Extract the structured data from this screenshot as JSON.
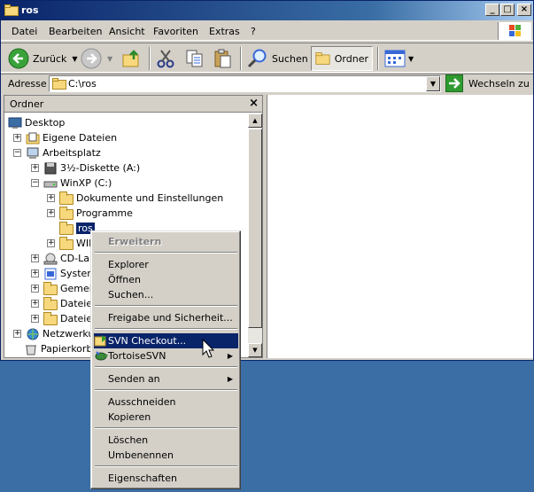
{
  "window": {
    "title": "ros"
  },
  "menu": [
    "Datei",
    "Bearbeiten",
    "Ansicht",
    "Favoriten",
    "Extras",
    "?"
  ],
  "toolbar": {
    "back_label": "Zurück",
    "search_label": "Suchen",
    "folders_label": "Ordner"
  },
  "address": {
    "label": "Adresse",
    "value": "C:\\ros",
    "go_label": "Wechseln zu"
  },
  "folderpane": {
    "title": "Ordner",
    "tree": [
      {
        "label": "Desktop",
        "icon": "desktop-icon"
      },
      {
        "label": "Eigene Dateien",
        "icon": "my-documents-icon",
        "expander": "+"
      },
      {
        "label": "Arbeitsplatz",
        "icon": "my-computer-icon",
        "expander": "−"
      },
      {
        "label": "3½-Diskette (A:)",
        "icon": "floppy-icon",
        "expander": "+"
      },
      {
        "label": "WinXP (C:)",
        "icon": "hard-drive-icon",
        "expander": "−"
      },
      {
        "label": "Dokumente und Einstellungen",
        "icon": "folder-icon",
        "expander": "+"
      },
      {
        "label": "Programme",
        "icon": "folder-icon",
        "expander": "+"
      },
      {
        "label": "ros",
        "icon": "folder-open-icon",
        "selected": true
      },
      {
        "label": "WIN",
        "icon": "folder-icon",
        "expander": "+"
      },
      {
        "label": "CD-Lau",
        "icon": "cd-drive-icon",
        "expander": "+"
      },
      {
        "label": "System",
        "icon": "control-panel-icon",
        "expander": "+"
      },
      {
        "label": "Gemein",
        "icon": "folder-icon",
        "expander": "+"
      },
      {
        "label": "Dateien",
        "icon": "folder-icon",
        "expander": "+"
      },
      {
        "label": "Dateien",
        "icon": "folder-icon",
        "expander": "+"
      },
      {
        "label": "Netzwerkum",
        "icon": "network-icon",
        "expander": "+"
      },
      {
        "label": "Papierkorb",
        "icon": "recycle-bin-icon"
      }
    ]
  },
  "context_menu": {
    "items": [
      {
        "label": "Erweitern",
        "style": "disabled"
      },
      {
        "label": "Explorer"
      },
      {
        "label": "Öffnen"
      },
      {
        "label": "Suchen..."
      },
      {
        "label": "Freigabe und Sicherheit..."
      },
      {
        "label": "SVN Checkout...",
        "style": "highlighted",
        "icon": "svn-checkout-icon"
      },
      {
        "label": "TortoiseSVN",
        "submenu": true,
        "icon": "tortoisesvn-icon"
      },
      {
        "label": "Senden an",
        "submenu": true
      },
      {
        "label": "Ausschneiden"
      },
      {
        "label": "Kopieren"
      },
      {
        "label": "Löschen"
      },
      {
        "label": "Umbenennen"
      },
      {
        "label": "Eigenschaften"
      }
    ]
  },
  "colors": {
    "selection": "#0a246a",
    "face": "#d4d0c8",
    "desktop": "#3a6ea5"
  }
}
